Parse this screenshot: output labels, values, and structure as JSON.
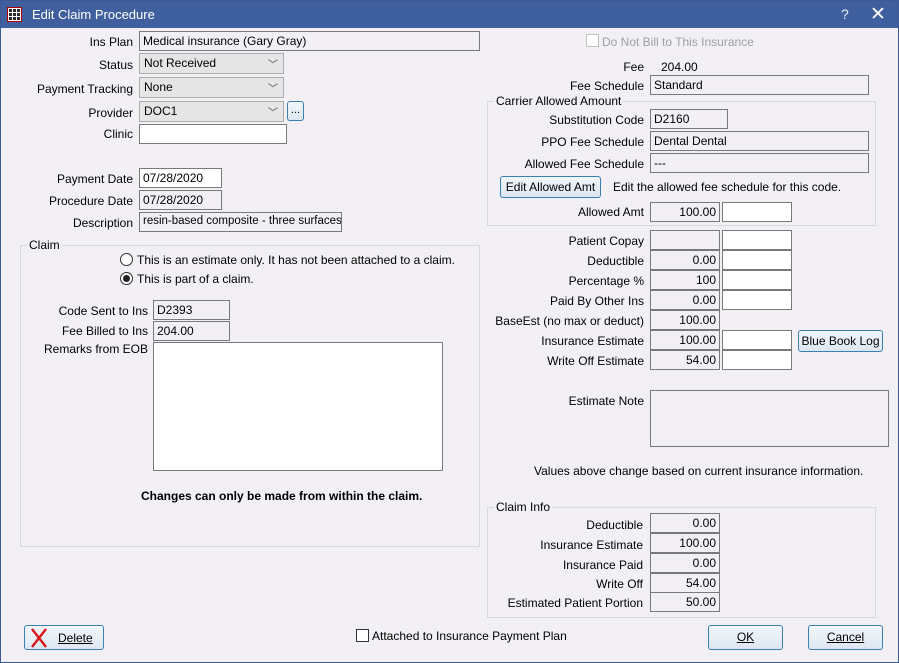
{
  "window": {
    "title": "Edit Claim Procedure",
    "help_label": "?",
    "close_label": "✕"
  },
  "left": {
    "ins_plan": {
      "label": "Ins Plan",
      "value": "Medical insurance (Gary Gray)"
    },
    "status": {
      "label": "Status",
      "value": "Not Received"
    },
    "payment_tracking": {
      "label": "Payment Tracking",
      "value": "None"
    },
    "provider": {
      "label": "Provider",
      "value": "DOC1",
      "picker_label": "..."
    },
    "clinic": {
      "label": "Clinic",
      "value": ""
    },
    "payment_date": {
      "label": "Payment Date",
      "value": "07/28/2020"
    },
    "procedure_date": {
      "label": "Procedure Date",
      "value": "07/28/2020"
    },
    "description": {
      "label": "Description",
      "value": "resin-based composite - three surfaces, pc"
    }
  },
  "claim_group": {
    "title": "Claim",
    "radio_estimate": "This is an estimate only. It has not been attached to a claim.",
    "radio_part_of_claim": "This is part of a claim.",
    "selected": "part_of_claim",
    "code_sent": {
      "label": "Code Sent to Ins",
      "value": "D2393"
    },
    "fee_billed": {
      "label": "Fee Billed to Ins",
      "value": "204.00"
    },
    "remarks": {
      "label": "Remarks from EOB",
      "value": ""
    },
    "notice": "Changes can only be made from within the claim."
  },
  "right": {
    "do_not_bill": {
      "label": "Do Not Bill to This Insurance",
      "checked": false,
      "disabled": true
    },
    "fee": {
      "label": "Fee",
      "value": "204.00"
    },
    "fee_schedule": {
      "label": "Fee Schedule",
      "value": "Standard"
    },
    "carrier_group": {
      "title": "Carrier Allowed Amount",
      "substitution_code": {
        "label": "Substitution Code",
        "value": "D2160"
      },
      "ppo_fee_schedule": {
        "label": "PPO Fee Schedule",
        "value": "Dental Dental"
      },
      "allowed_fee_schedule": {
        "label": "Allowed Fee Schedule",
        "value": "---"
      },
      "edit_button": "Edit Allowed Amt",
      "edit_hint": "Edit the allowed fee schedule for this code.",
      "allowed_amt": {
        "label": "Allowed Amt",
        "value": "100.00",
        "override": ""
      }
    },
    "estimates": [
      {
        "label": "Patient Copay",
        "value": "",
        "override": ""
      },
      {
        "label": "Deductible",
        "value": "0.00",
        "override": ""
      },
      {
        "label": "Percentage %",
        "value": "100",
        "override": ""
      },
      {
        "label": "Paid By Other Ins",
        "value": "0.00",
        "override": ""
      },
      {
        "label": "BaseEst (no max or deduct)",
        "value": "100.00"
      },
      {
        "label": "Insurance Estimate",
        "value": "100.00",
        "override": ""
      },
      {
        "label": "Write Off Estimate",
        "value": "54.00",
        "override": ""
      }
    ],
    "blue_book_button": "Blue Book Log",
    "estimate_note": {
      "label": "Estimate Note",
      "value": ""
    },
    "values_note": "Values above change based on current insurance information.",
    "claim_info": {
      "title": "Claim Info",
      "rows": [
        {
          "label": "Deductible",
          "value": "0.00"
        },
        {
          "label": "Insurance Estimate",
          "value": "100.00"
        },
        {
          "label": "Insurance Paid",
          "value": "0.00"
        },
        {
          "label": "Write Off",
          "value": "54.00"
        },
        {
          "label": "Estimated Patient Portion",
          "value": "50.00"
        }
      ]
    }
  },
  "footer": {
    "delete_label": "Delete",
    "attached_payment_plan": {
      "label": "Attached to Insurance Payment Plan",
      "checked": false
    },
    "ok_label": "OK",
    "cancel_label": "Cancel"
  }
}
